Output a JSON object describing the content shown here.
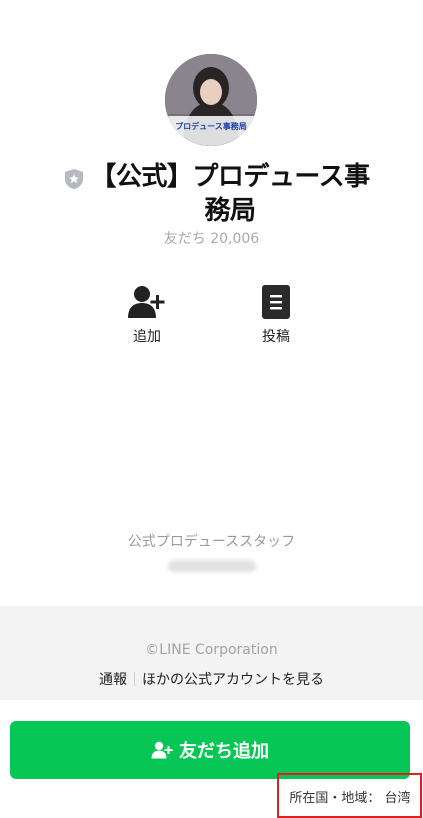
{
  "profile": {
    "avatar_caption": "プロデュース事務局",
    "title": "【公式】プロデュース事務局",
    "friends": "友だち 20,006",
    "badge_icon": "official-badge-icon"
  },
  "actions": [
    {
      "label": "追加",
      "icon": "add-friend-icon"
    },
    {
      "label": "投稿",
      "icon": "post-icon"
    }
  ],
  "staff": {
    "name": "公式プロデューススタッフ"
  },
  "footer": {
    "copyright": "©LINE Corporation",
    "report": "通報",
    "other_accounts": "ほかの公式アカウントを見る"
  },
  "add_button": {
    "label": "友だち追加"
  },
  "region": {
    "text": "所在国・地域： 台湾"
  },
  "colors": {
    "accent": "#06c755",
    "highlight": "#e02020"
  }
}
